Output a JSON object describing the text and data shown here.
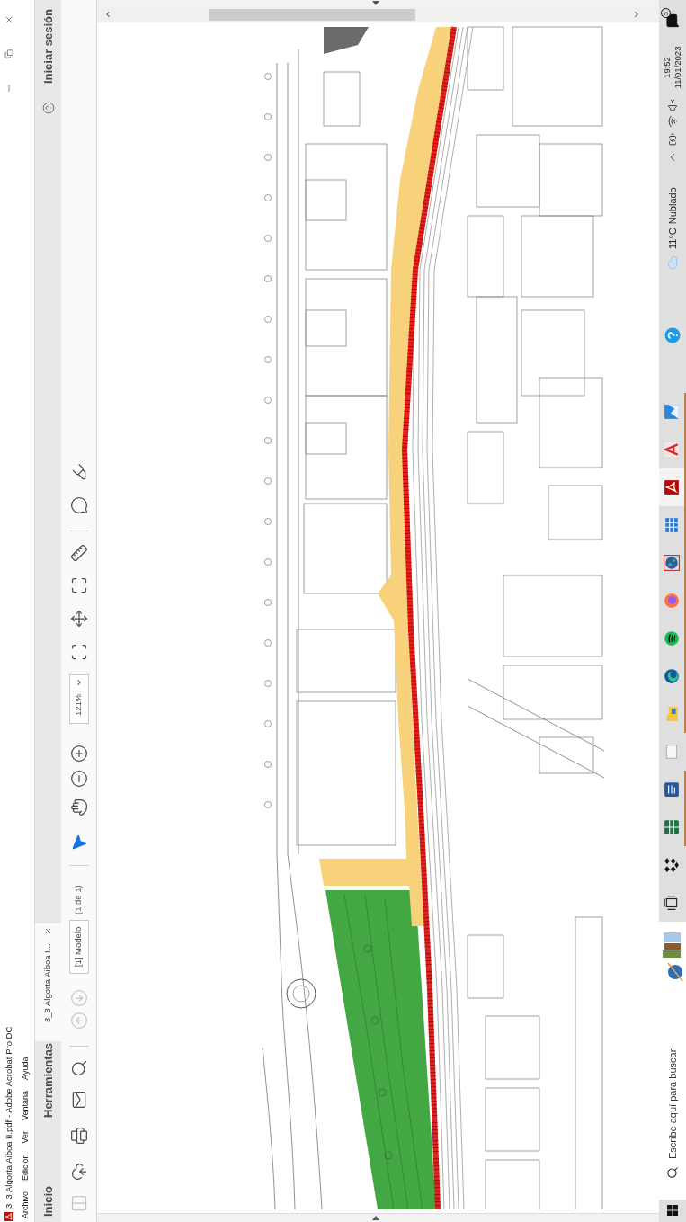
{
  "window": {
    "title": "3_3 Algorta Aiboa II.pdf - Adobe Acrobat Pro DC"
  },
  "menu": [
    "Archivo",
    "Edición",
    "Ver",
    "Ventana",
    "Ayuda"
  ],
  "tabs": [
    {
      "label": "Inicio",
      "kind": "nav",
      "selected": false
    },
    {
      "label": "Herramientas",
      "kind": "nav",
      "selected": false
    },
    {
      "label": "3_3 Algorta Aiboa I...",
      "kind": "document",
      "selected": true
    }
  ],
  "account": {
    "label": "Iniciar sesión"
  },
  "toolbar": {
    "actions": [
      {
        "kind": "pages",
        "disabled": true
      },
      {
        "kind": "upload",
        "disabled": false
      },
      {
        "kind": "print",
        "disabled": false
      },
      {
        "kind": "mail",
        "disabled": false
      },
      {
        "kind": "search",
        "disabled": false
      }
    ],
    "page_nav": [
      {
        "kind": "previous",
        "disabled": true
      },
      {
        "kind": "next",
        "disabled": true
      }
    ],
    "page_field": {
      "value": "[1] Modelo"
    },
    "page_count": "(1 de 1)",
    "modes": [
      {
        "kind": "pointer",
        "selected": true
      },
      {
        "kind": "hand",
        "selected": false
      }
    ],
    "zoom": {
      "value": "121%"
    }
  },
  "taskbar": {
    "search": {
      "placeholder": "Escribe aquí para buscar"
    },
    "apps": [
      {
        "kind": "taskview",
        "running": false,
        "selected": false
      },
      {
        "kind": "diamonds",
        "running": false,
        "selected": false
      },
      {
        "kind": "sheet",
        "running": true,
        "selected": false
      },
      {
        "kind": "doc",
        "running": true,
        "selected": false
      },
      {
        "kind": "blank",
        "running": false,
        "selected": false
      },
      {
        "kind": "folder",
        "running": true,
        "selected": false
      },
      {
        "kind": "swirl",
        "running": true,
        "selected": false
      },
      {
        "kind": "waves",
        "running": true,
        "selected": false
      },
      {
        "kind": "flame",
        "running": true,
        "selected": false
      },
      {
        "kind": "globe",
        "running": true,
        "selected": false
      },
      {
        "kind": "table",
        "running": true,
        "selected": false
      },
      {
        "kind": "pdf",
        "running": true,
        "selected": true
      },
      {
        "kind": "triangle",
        "running": true,
        "selected": false
      },
      {
        "kind": "picture",
        "running": true,
        "selected": false
      }
    ],
    "weather": {
      "temperature": "11°C",
      "condition": "Nublado"
    },
    "clock": {
      "time": "19:52",
      "date": "11/01/2023"
    },
    "notifications": {
      "count": "5"
    }
  }
}
